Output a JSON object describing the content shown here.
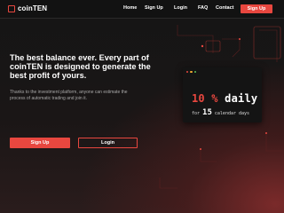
{
  "brand": {
    "name": "coinTEN"
  },
  "nav": {
    "links": [
      "Home",
      "Sign Up",
      "Login",
      "FAQ",
      "Contact"
    ],
    "cta": "Sign Up"
  },
  "hero": {
    "headline": "The best balance ever. Every part of coinTEN is designed to generate the best profit of yours.",
    "subtext": "Thanks to the investment platform, anyone can estimate the process of automatic trading and join it.",
    "primary_button": "Sign Up",
    "secondary_button": "Login"
  },
  "card": {
    "rate_number": "10",
    "rate_symbol": "%",
    "rate_suffix": "daily",
    "period_prefix": "for",
    "period_number": "15",
    "period_suffix": "calendar days",
    "dot_colors": [
      "#e8473f",
      "#f0a830",
      "#5ac05a"
    ]
  },
  "colors": {
    "accent": "#e8473f",
    "background": "#141414"
  }
}
